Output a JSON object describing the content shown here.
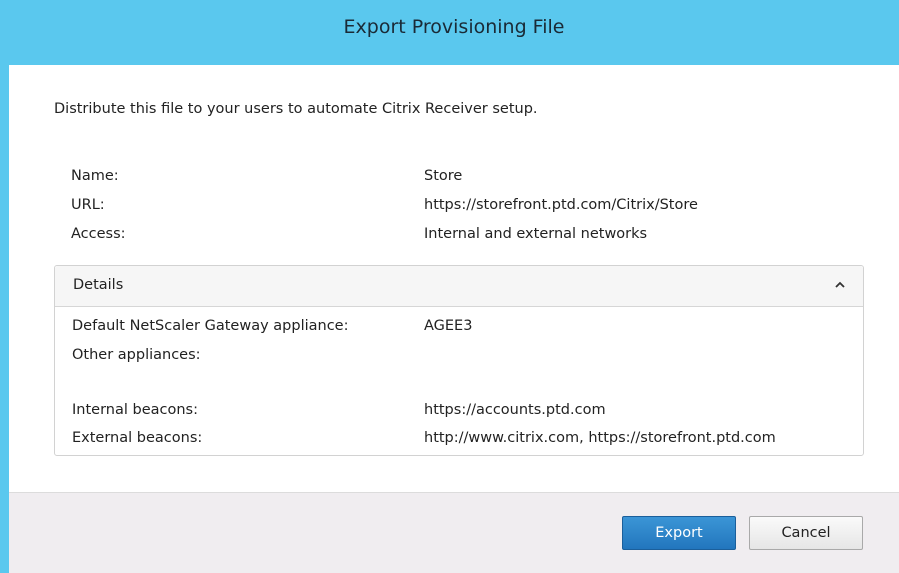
{
  "window": {
    "title": "Export Provisioning File"
  },
  "intro": "Distribute this file to your users to automate Citrix Receiver setup.",
  "store_info": [
    {
      "label": "Name:",
      "value": "Store"
    },
    {
      "label": "URL:",
      "value": "https://storefront.ptd.com/Citrix/Store"
    },
    {
      "label": "Access:",
      "value": "Internal and external networks"
    }
  ],
  "details": {
    "title": "Details",
    "expanded": true,
    "icon": "chevron-up-icon",
    "rows": [
      {
        "label": "Default NetScaler Gateway appliance:",
        "value": "AGEE3"
      },
      {
        "label": "Other appliances:",
        "value": ""
      },
      {
        "label": "Internal beacons:",
        "value": "https://accounts.ptd.com"
      },
      {
        "label": "External beacons:",
        "value": "http://www.citrix.com, https://storefront.ptd.com"
      }
    ]
  },
  "buttons": {
    "export_label": "Export",
    "cancel_label": "Cancel"
  },
  "colors": {
    "titlebar": "#5ac8ee",
    "primary_button": "#2f86cc",
    "footer": "#f0edf0"
  }
}
